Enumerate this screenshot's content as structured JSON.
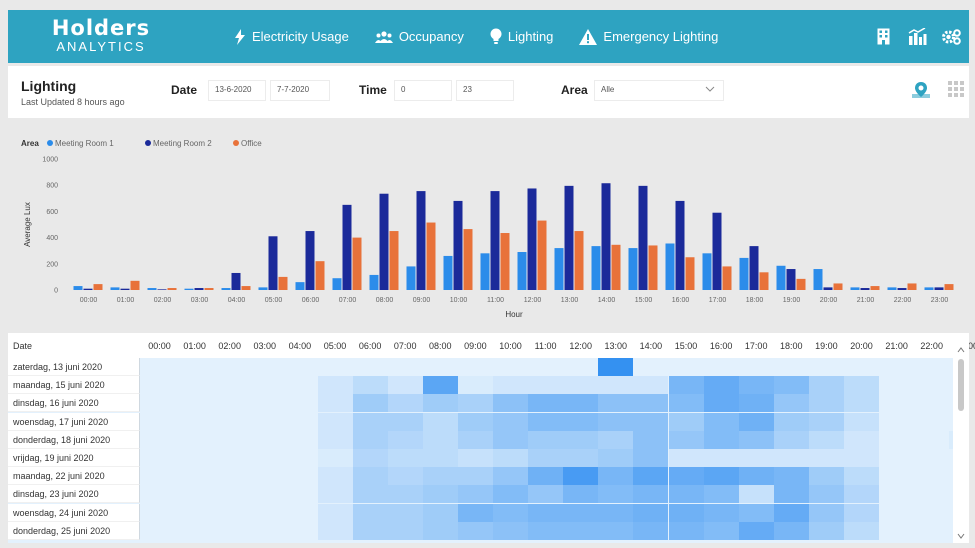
{
  "brand": {
    "name": "Holders",
    "sub": "ANALYTICS"
  },
  "nav": [
    {
      "label": "Electricity Usage",
      "icon": "lightning-bolt-icon"
    },
    {
      "label": "Occupancy",
      "icon": "people-icon"
    },
    {
      "label": "Lighting",
      "icon": "lightbulb-icon"
    },
    {
      "label": "Emergency Lighting",
      "icon": "warning-triangle-icon"
    }
  ],
  "top_icons": [
    "building-icon",
    "city-chart-icon",
    "settings-gears-icon"
  ],
  "page": {
    "title": "Lighting",
    "updated": "Last Updated 8 hours ago"
  },
  "filters": {
    "date_label": "Date",
    "date_from": "13-6-2020",
    "date_to": "7-7-2020",
    "time_label": "Time",
    "time_from": "0",
    "time_to": "23",
    "area_label": "Area",
    "area_value": "Alle"
  },
  "view_icons": [
    "map-pin-icon",
    "grid-icon"
  ],
  "colors": {
    "header": "#2ea3c1",
    "meeting_room_1": "#2b8cea",
    "meeting_room_2": "#1b2a9a",
    "office": "#e8723a"
  },
  "chart_data": {
    "type": "bar",
    "legend_title": "Area",
    "ylabel": "Average Lux",
    "xlabel": "Hour",
    "ylim": [
      0,
      1000
    ],
    "yticks": [
      0,
      200,
      400,
      600,
      800,
      1000
    ],
    "categories": [
      "00:00",
      "01:00",
      "02:00",
      "03:00",
      "04:00",
      "05:00",
      "06:00",
      "07:00",
      "08:00",
      "09:00",
      "10:00",
      "11:00",
      "12:00",
      "13:00",
      "14:00",
      "15:00",
      "16:00",
      "17:00",
      "18:00",
      "19:00",
      "20:00",
      "21:00",
      "22:00",
      "23:00"
    ],
    "series": [
      {
        "name": "Meeting Room 1",
        "values": [
          30,
          20,
          15,
          10,
          15,
          20,
          60,
          90,
          115,
          180,
          260,
          280,
          290,
          320,
          335,
          320,
          355,
          280,
          245,
          185,
          160,
          20,
          20,
          20
        ]
      },
      {
        "name": "Meeting Room 2",
        "values": [
          10,
          10,
          5,
          15,
          130,
          410,
          450,
          650,
          735,
          755,
          680,
          755,
          775,
          795,
          815,
          795,
          680,
          590,
          335,
          160,
          20,
          15,
          15,
          20
        ]
      },
      {
        "name": "Office",
        "values": [
          45,
          70,
          15,
          15,
          30,
          100,
          220,
          400,
          450,
          515,
          465,
          435,
          530,
          450,
          345,
          340,
          250,
          180,
          135,
          85,
          50,
          30,
          50,
          45
        ]
      }
    ]
  },
  "table": {
    "date_header": "Date",
    "hours": [
      "00:00",
      "01:00",
      "02:00",
      "03:00",
      "04:00",
      "05:00",
      "06:00",
      "07:00",
      "08:00",
      "09:00",
      "10:00",
      "11:00",
      "12:00",
      "13:00",
      "14:00",
      "15:00",
      "16:00",
      "17:00",
      "18:00",
      "19:00",
      "20:00",
      "21:00",
      "22:00",
      "23:00"
    ],
    "rows": [
      {
        "date": "zaterdag, 13 juni 2020",
        "levels": [
          0,
          0,
          0,
          0,
          0,
          0,
          0,
          0,
          0,
          0,
          0,
          0,
          0,
          0.9,
          0,
          0,
          0,
          0,
          0,
          0,
          0,
          0,
          0,
          0
        ]
      },
      {
        "date": "maandag, 15 juni 2020",
        "levels": [
          0,
          0,
          0,
          0,
          0,
          0.1,
          0.2,
          0.1,
          0.7,
          0.05,
          0.1,
          0.1,
          0.1,
          0.1,
          0.1,
          0.55,
          0.65,
          0.55,
          0.5,
          0.3,
          0.2,
          0,
          0,
          0
        ]
      },
      {
        "date": "dinsdag, 16 juni 2020",
        "levels": [
          0,
          0,
          0,
          0,
          0,
          0.1,
          0.35,
          0.25,
          0.35,
          0.3,
          0.45,
          0.55,
          0.55,
          0.45,
          0.45,
          0.5,
          0.65,
          0.6,
          0.4,
          0.3,
          0.2,
          0,
          0,
          0
        ]
      },
      {
        "date": "woensdag, 17 juni 2020",
        "levels": [
          0,
          0,
          0,
          0,
          0,
          0.1,
          0.3,
          0.3,
          0.2,
          0.35,
          0.4,
          0.5,
          0.5,
          0.45,
          0.45,
          0.35,
          0.5,
          0.6,
          0.35,
          0.3,
          0.15,
          0,
          0,
          0
        ]
      },
      {
        "date": "donderdag, 18 juni 2020",
        "levels": [
          0,
          0,
          0,
          0,
          0,
          0.1,
          0.3,
          0.25,
          0.2,
          0.3,
          0.4,
          0.35,
          0.35,
          0.3,
          0.45,
          0.4,
          0.5,
          0.45,
          0.3,
          0.2,
          0.1,
          0,
          0,
          0.05
        ]
      },
      {
        "date": "vrijdag, 19 juni 2020",
        "levels": [
          0,
          0,
          0,
          0,
          0,
          0.05,
          0.25,
          0.2,
          0.2,
          0.15,
          0.2,
          0.3,
          0.3,
          0.35,
          0.45,
          0.1,
          0.1,
          0.1,
          0.1,
          0.1,
          0.1,
          0,
          0,
          0
        ]
      },
      {
        "date": "maandag, 22 juni 2020",
        "levels": [
          0,
          0,
          0,
          0,
          0,
          0.1,
          0.3,
          0.25,
          0.3,
          0.3,
          0.4,
          0.6,
          0.8,
          0.55,
          0.7,
          0.65,
          0.7,
          0.6,
          0.55,
          0.35,
          0.2,
          0,
          0,
          0
        ]
      },
      {
        "date": "dinsdag, 23 juni 2020",
        "levels": [
          0,
          0,
          0,
          0,
          0,
          0.1,
          0.3,
          0.3,
          0.35,
          0.4,
          0.5,
          0.4,
          0.55,
          0.5,
          0.55,
          0.55,
          0.5,
          0.15,
          0.55,
          0.4,
          0.25,
          0,
          0,
          0
        ]
      },
      {
        "date": "woensdag, 24 juni 2020",
        "levels": [
          0,
          0,
          0,
          0,
          0,
          0.1,
          0.3,
          0.3,
          0.35,
          0.55,
          0.5,
          0.55,
          0.55,
          0.55,
          0.6,
          0.6,
          0.55,
          0.5,
          0.65,
          0.4,
          0.25,
          0,
          0,
          0
        ]
      },
      {
        "date": "donderdag, 25 juni 2020",
        "levels": [
          0,
          0,
          0,
          0,
          0,
          0.1,
          0.3,
          0.3,
          0.35,
          0.4,
          0.45,
          0.5,
          0.5,
          0.5,
          0.55,
          0.55,
          0.5,
          0.65,
          0.55,
          0.35,
          0.2,
          0,
          0,
          0
        ]
      }
    ]
  }
}
